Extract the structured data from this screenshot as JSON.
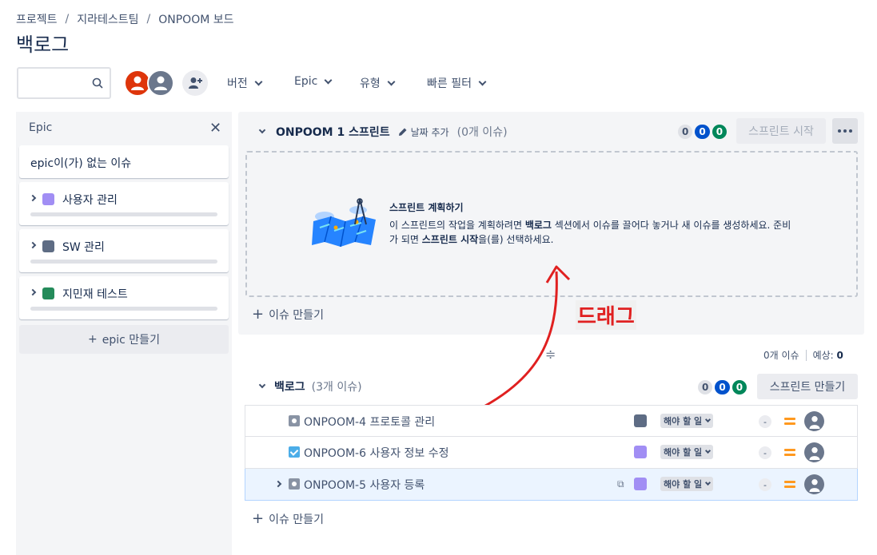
{
  "breadcrumb": [
    "프로젝트",
    "지라테스트팀",
    "ONPOOM 보드"
  ],
  "page_title": "백로그",
  "toolbar": {
    "search_placeholder": "",
    "filters": [
      "버전",
      "Epic",
      "유형",
      "빠른 필터"
    ]
  },
  "epic_panel": {
    "title": "Epic",
    "items": [
      {
        "label": "epic이(가) 없는 이슈"
      },
      {
        "label": "사용자 관리",
        "color": "#a18ef4"
      },
      {
        "label": "SW 관리",
        "color": "#5e6c84"
      },
      {
        "label": "지민재 테스트",
        "color": "#248b5a"
      }
    ],
    "create_label": "epic 만들기"
  },
  "sprint": {
    "name": "ONPOOM 1 스프린트",
    "add_date": "날짜 추가",
    "issue_count": "(0개 이슈)",
    "badges": [
      "0",
      "0",
      "0"
    ],
    "start_button": "스프린트 시작",
    "empty_title": "스프린트 계획하기",
    "empty_desc_1": "이 스프린트의 작업을 계획하려면 ",
    "empty_desc_bold1": "백로그",
    "empty_desc_2": " 섹션에서 이슈를 끌어다 놓거나 새 이슈를 생성하세요. 준비가 되면 ",
    "empty_desc_bold2": "스프린트 시작",
    "empty_desc_3": "을(를) 선택하세요.",
    "create_issue": "이슈 만들기"
  },
  "annotation": {
    "drag_label": "드래그",
    "color": "#e02020"
  },
  "backlog_stats": {
    "issues": "0개 이슈",
    "estimate_label": "예상:",
    "estimate_value": "0"
  },
  "backlog": {
    "name": "백로그",
    "issue_count": "(3개 이슈)",
    "badges": [
      "0",
      "0",
      "0"
    ],
    "create_sprint": "스프린트 만들기",
    "create_issue": "이슈 만들기",
    "rows": [
      {
        "key": "ONPOOM-4 프로토콜 관리",
        "type": "subtask",
        "epic_color": "#5e6c84",
        "status": "해야 할 일",
        "estimate": "-"
      },
      {
        "key": "ONPOOM-6 사용자 정보 수정",
        "type": "task",
        "epic_color": "#a18ef4",
        "status": "해야 할 일",
        "estimate": "-"
      },
      {
        "key": "ONPOOM-5 사용자 등록",
        "type": "subtask",
        "epic_color": "#a18ef4",
        "status": "해야 할 일",
        "estimate": "-",
        "selected": true
      }
    ]
  }
}
